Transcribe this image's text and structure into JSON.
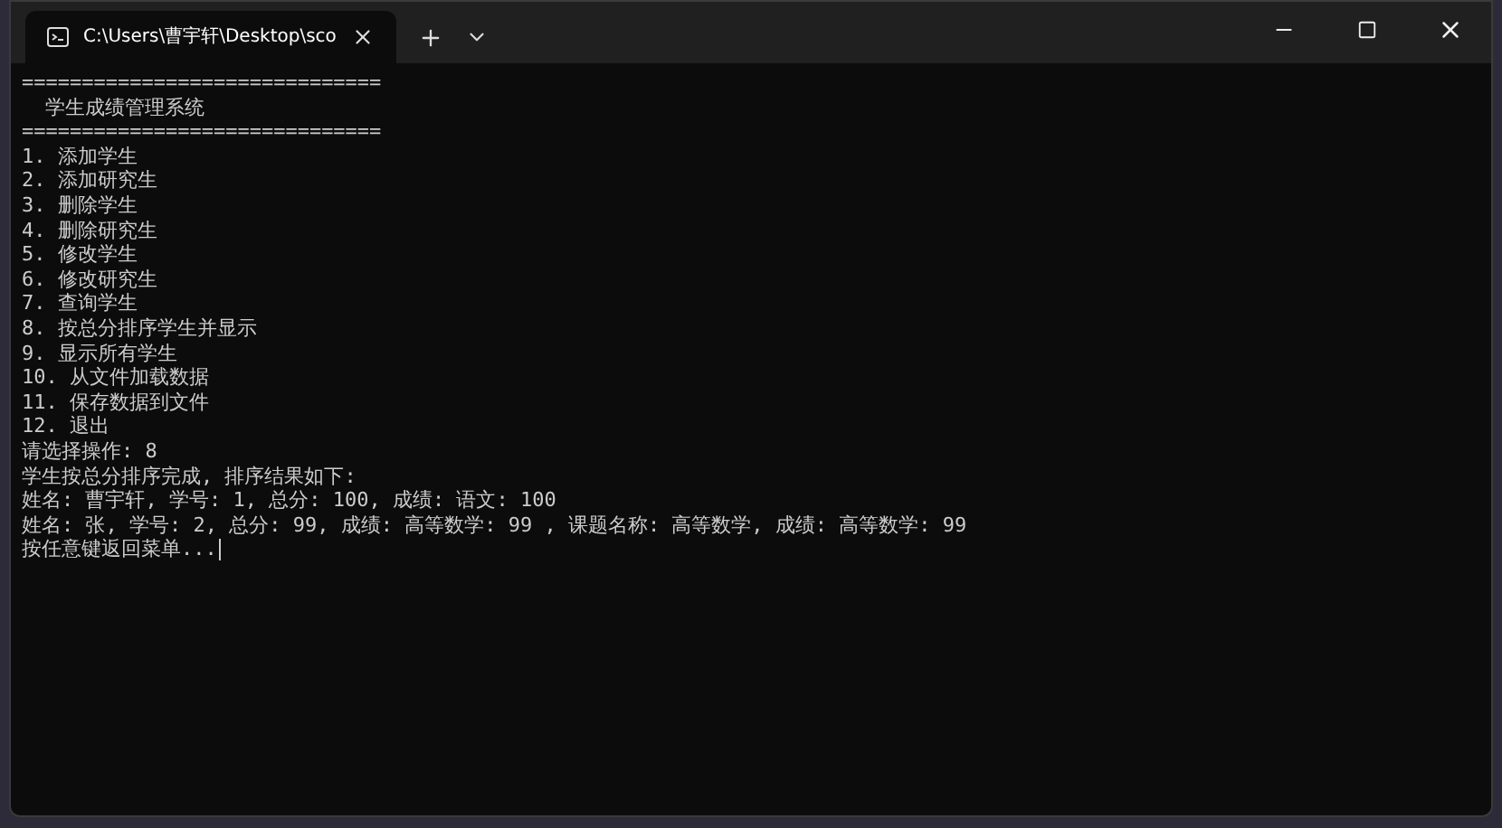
{
  "tabs": [
    {
      "title": "C:\\Users\\曹宇轩\\Desktop\\sco",
      "selected": true
    }
  ],
  "console_lines": [
    "==============================",
    "  学生成绩管理系统",
    "==============================",
    "1. 添加学生",
    "2. 添加研究生",
    "3. 删除学生",
    "4. 删除研究生",
    "5. 修改学生",
    "6. 修改研究生",
    "7. 查询学生",
    "8. 按总分排序学生并显示",
    "9. 显示所有学生",
    "10. 从文件加载数据",
    "11. 保存数据到文件",
    "12. 退出",
    "请选择操作: 8",
    "学生按总分排序完成, 排序结果如下:",
    "姓名: 曹宇轩, 学号: 1, 总分: 100, 成绩: 语文: 100",
    "姓名: 张, 学号: 2, 总分: 99, 成绩: 高等数学: 99 , 课题名称: 高等数学, 成绩: 高等数学: 99",
    "按任意键返回菜单..."
  ]
}
